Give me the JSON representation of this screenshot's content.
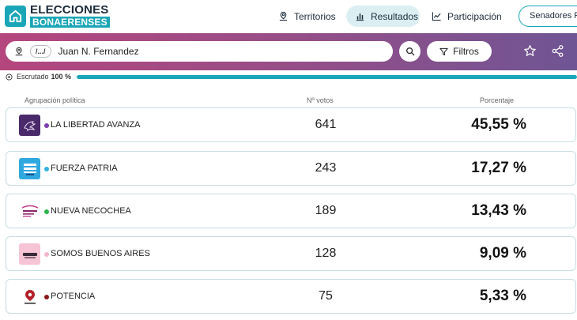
{
  "app": {
    "logo_line1": "ELECCIONES",
    "logo_line2": "BONAERENSES",
    "brand_color": "#1aa6b7"
  },
  "nav": {
    "territorios": "Territorios",
    "resultados": "Resultados",
    "participacion": "Participación",
    "senadores": "Senadores Pro"
  },
  "search": {
    "chip": "/.../",
    "value": "Juan N. Fernandez",
    "filters_label": "Filtros"
  },
  "status": {
    "escrutado_label": "Escrutado",
    "escrutado_value": "100 %",
    "progress_fraction": 1.0
  },
  "table": {
    "headers": {
      "party": "Agrupación política",
      "votes": "Nº votos",
      "pct": "Porcentaje"
    },
    "rows": [
      {
        "party": "LA LIBERTAD AVANZA",
        "votes": "641",
        "pct": "45,55 %",
        "dot_color": "#7b3fb0",
        "logo_bg": "#4a2a6a",
        "logo_icon": "lion-icon"
      },
      {
        "party": "FUERZA PATRIA",
        "votes": "243",
        "pct": "17,27 %",
        "dot_color": "#35b2e0",
        "logo_bg": "#2fa8e0",
        "logo_icon": "flag-icon"
      },
      {
        "party": "NUEVA NECOCHEA",
        "votes": "189",
        "pct": "13,43 %",
        "dot_color": "#2db34a",
        "logo_bg": "#ffffff",
        "logo_icon": "nueva-necochea-logo-icon"
      },
      {
        "party": "SOMOS BUENOS AIRES",
        "votes": "128",
        "pct": "9,09 %",
        "dot_color": "#f4b6cc",
        "logo_bg": "#f6c4d4",
        "logo_icon": "somos-logo-icon"
      },
      {
        "party": "POTENCIA",
        "votes": "75",
        "pct": "5,33 %",
        "dot_color": "#8b1a1a",
        "logo_bg": "#ffffff",
        "logo_icon": "potencia-logo-icon"
      }
    ]
  }
}
